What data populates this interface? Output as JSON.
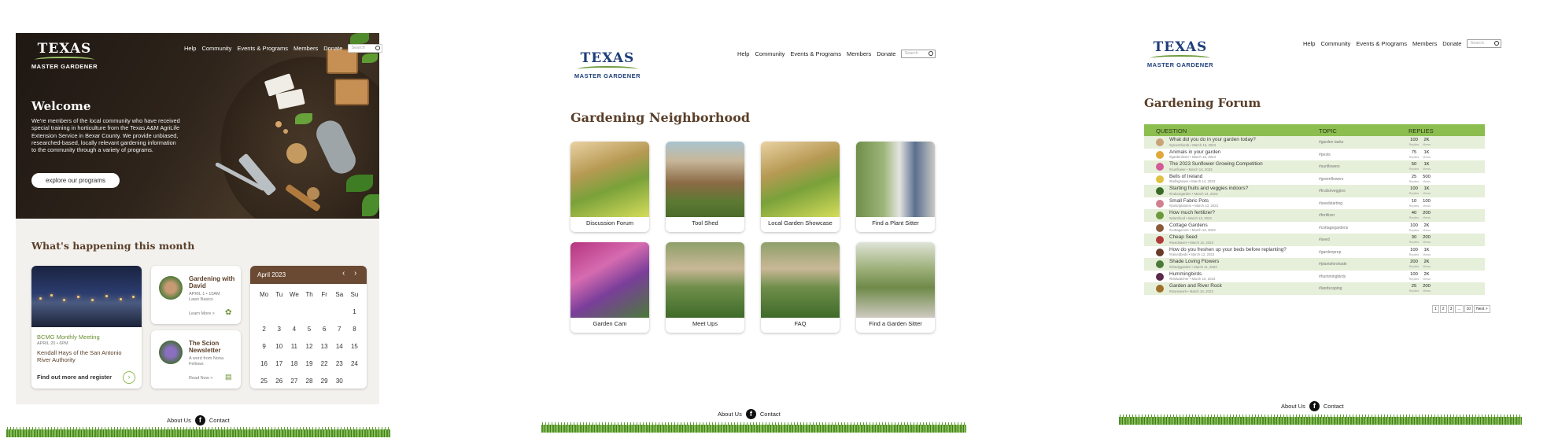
{
  "brand": {
    "logo_line1": "TEXAS",
    "logo_line2": "MASTER GARDENER"
  },
  "nav": {
    "items": [
      "Help",
      "Community",
      "Events & Programs",
      "Members",
      "Donate"
    ],
    "search_placeholder": "Search"
  },
  "home": {
    "welcome_title": "Welcome",
    "welcome_text": "We're members of the local community who have received special training in horticulture from the Texas A&M AgriLife Extension Service in Bexar County. We provide unbiased, researched-based, locally relevant gardening information to the community through a variety of programs.",
    "cta_label": "explore our programs",
    "happening_title": "What's happening this month",
    "event": {
      "title": "BCMG Monthly Meeting",
      "date": "APRIL 20 • 6PM",
      "speaker": "Kendall Hays of the San Antonio River Authority",
      "link": "Find out more and register"
    },
    "card1": {
      "title": "Gardening with David",
      "subtitle": "APRIL 1 • 10AM",
      "desc": "Lawn Basics",
      "link": "Learn More >"
    },
    "card2": {
      "title": "The Scion Newsletter",
      "desc": "A word from Nona Fellows",
      "link": "Read Now >"
    },
    "calendar": {
      "month": "April 2023",
      "weekdays": [
        "Mo",
        "Tu",
        "We",
        "Th",
        "Fr",
        "Sa",
        "Su"
      ],
      "rows": [
        [
          "",
          "",
          "",
          "",
          "",
          "",
          "1"
        ],
        [
          "2",
          "3",
          "4",
          "5",
          "6",
          "7",
          "8"
        ],
        [
          "9",
          "10",
          "11",
          "12",
          "13",
          "14",
          "15"
        ],
        [
          "16",
          "17",
          "18",
          "19",
          "20",
          "21",
          "22"
        ],
        [
          "23",
          "24",
          "25",
          "26",
          "27",
          "28",
          "29"
        ]
      ],
      "shown_rows": [
        [
          "",
          "",
          "",
          "",
          "",
          "",
          "1"
        ],
        [
          "2",
          "3",
          "4",
          "5",
          "6",
          "7",
          "8"
        ],
        [
          "9",
          "10",
          "11",
          "12",
          "13",
          "14",
          "15"
        ],
        [
          "16",
          "17",
          "18",
          "19",
          "22",
          "23",
          "24"
        ],
        [
          "25",
          "26",
          "27",
          "28",
          "29",
          "30",
          ""
        ]
      ]
    }
  },
  "neighborhood": {
    "title": "Gardening Neighborhood",
    "tiles": [
      "Discussion Forum",
      "Tool Shed",
      "Local Garden Showcase",
      "Find a Plant Sitter",
      "Garden Cam",
      "Meet Ups",
      "FAQ",
      "Find a Garden Sitter"
    ]
  },
  "forum": {
    "title": "Gardening Forum",
    "columns": [
      "QUESTION",
      "TOPIC",
      "REPLIES"
    ],
    "rows": [
      {
        "q": "What did you do in your garden today?",
        "meta": "#greenthumb • March 15, 2023",
        "topic": "#garden tasks",
        "a": "100",
        "b": "2K"
      },
      {
        "q": "Animals in your garden",
        "meta": "#gardenlover • March 15, 2023",
        "topic": "#pests",
        "a": "75",
        "b": "1K"
      },
      {
        "q": "The 2023 Sunflower Growing Competition",
        "meta": "#sunflower • March 14, 2023",
        "topic": "#sunflowers",
        "a": "50",
        "b": "1K"
      },
      {
        "q": "Bells of Ireland",
        "meta": "#bellsgrower • March 14, 2023",
        "topic": "#greenflowers",
        "a": "25",
        "b": "500"
      },
      {
        "q": "Starting fruits and veggies indoors?",
        "meta": "#indoorgarden • March 14, 2023",
        "topic": "#fruitsnveggies",
        "a": "100",
        "b": "1K"
      },
      {
        "q": "Small Fabric Pots",
        "meta": "#potsnplanters • March 13, 2023",
        "topic": "#seedstarting",
        "a": "10",
        "b": "100"
      },
      {
        "q": "How much fertilizer?",
        "meta": "#plantfood • March 13, 2023",
        "topic": "#fertilizer",
        "a": "40",
        "b": "200"
      },
      {
        "q": "Cottage Gardens",
        "meta": "#cottagecore • March 12, 2023",
        "topic": "#cottagegardens",
        "a": "100",
        "b": "2K"
      },
      {
        "q": "Cheap Seed",
        "meta": "#seedsaver • March 12, 2023",
        "topic": "#seed",
        "a": "30",
        "b": "200"
      },
      {
        "q": "How do you freshen up your beds before replanting?",
        "meta": "#raisedbeds • March 12, 2023",
        "topic": "#gardenprep",
        "a": "100",
        "b": "1K"
      },
      {
        "q": "Shade Loving Flowers",
        "meta": "#shadygarden • March 11, 2023",
        "topic": "#plantsforshade",
        "a": "200",
        "b": "2K"
      },
      {
        "q": "Hummingbirds",
        "meta": "#birdwatcher • March 10, 2023",
        "topic": "#hummingbirds",
        "a": "100",
        "b": "2K"
      },
      {
        "q": "Garden and River Rock",
        "meta": "#stonework • March 10, 2023",
        "topic": "#landscaping",
        "a": "25",
        "b": "200"
      }
    ],
    "sub_a": "Replies",
    "sub_b": "Views",
    "pager": [
      "1",
      "2",
      "3",
      "...",
      "10",
      "Next >"
    ]
  },
  "footer": {
    "about": "About Us",
    "contact": "Contact",
    "fb": "f"
  }
}
